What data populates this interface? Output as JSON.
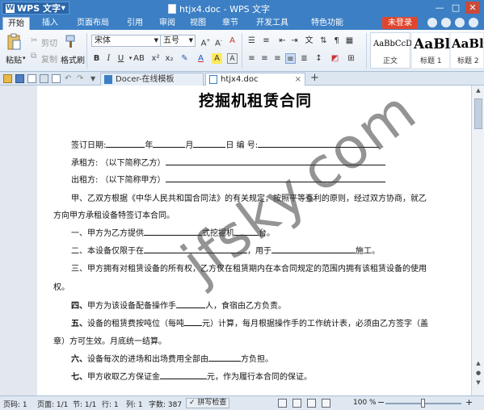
{
  "window": {
    "app_button": "WPS 文字",
    "title": "htjx4.doc - WPS 文字",
    "minimize": "—",
    "maximize": "□",
    "close": "✕"
  },
  "menu": {
    "tabs": [
      "开始",
      "插入",
      "页面布局",
      "引用",
      "审阅",
      "视图",
      "章节",
      "开发工具",
      "特色功能"
    ],
    "active": "开始",
    "login": "未登录"
  },
  "ribbon": {
    "paste": "粘贴",
    "cut": "剪切",
    "copy": "复制",
    "format_painter": "格式刷",
    "font_name": "宋体",
    "font_size": "五号",
    "styles": [
      {
        "sample": "AaBbCcDd",
        "label": "正文"
      },
      {
        "sample": "AaBl",
        "label": "标题 1"
      },
      {
        "sample": "AaBl",
        "label": "标题 2"
      }
    ]
  },
  "tabs": {
    "docer": "Docer-在线模板",
    "doc": "htjx4.doc",
    "add": "+"
  },
  "document": {
    "title": "挖掘机租赁合同",
    "lines": {
      "l1a": "签订日期:",
      "l1b": "年",
      "l1c": "月",
      "l1d": "日  编  号:",
      "l2": "承租方:  （以下简称乙方）",
      "l3": "出租方:  （以下简称甲方）",
      "l4": "甲、乙双方根据《中华人民共和国合同法》的有关规定，按照平等互利的原则，经过双方协商，就乙",
      "l5": "方向甲方承租设备特签订本合同。",
      "l6a": "一、甲方为乙方提供",
      "l6b": "式挖掘机",
      "l6c": "台。",
      "l7a": "二、本设备仅限于在",
      "l7b": "，用于",
      "l7c": "施工。",
      "l8": "三、甲方拥有对租赁设备的所有权，乙方仅在租赁期内在本合同规定的范围内拥有该租赁设备的使用",
      "l9": "权。",
      "l10a": "四、",
      "l10b": "甲方为该设备配备操作手",
      "l10c": "人，食宿由乙方负责。",
      "l11a": "五、",
      "l11b": "设备的租赁费按吨位（每吨",
      "l11c": "元）计算，每月根据操作手的工作统计表，必须由乙方签字（盖",
      "l12": "章）方可生效。月底统一结算。",
      "l13a": "六、",
      "l13b": "设备每次的进场和出场费用全部由",
      "l13c": "方负担。",
      "l14a": "七、",
      "l14b": "甲方收取乙方保证金",
      "l14c": "元，作为履行本合同的保证。"
    },
    "watermark": "jfsky.com"
  },
  "status": {
    "page": "页码: 1",
    "pages": "页面: 1/1",
    "section": "节: 1/1",
    "row": "行: 1",
    "col": "列: 1",
    "words": "字数: 387",
    "spell": "拼写检查",
    "zoom": "100 %",
    "zoom_level": 0.5
  },
  "colors": {
    "titlebar": "#3c7fc4",
    "login": "#e0462f"
  }
}
